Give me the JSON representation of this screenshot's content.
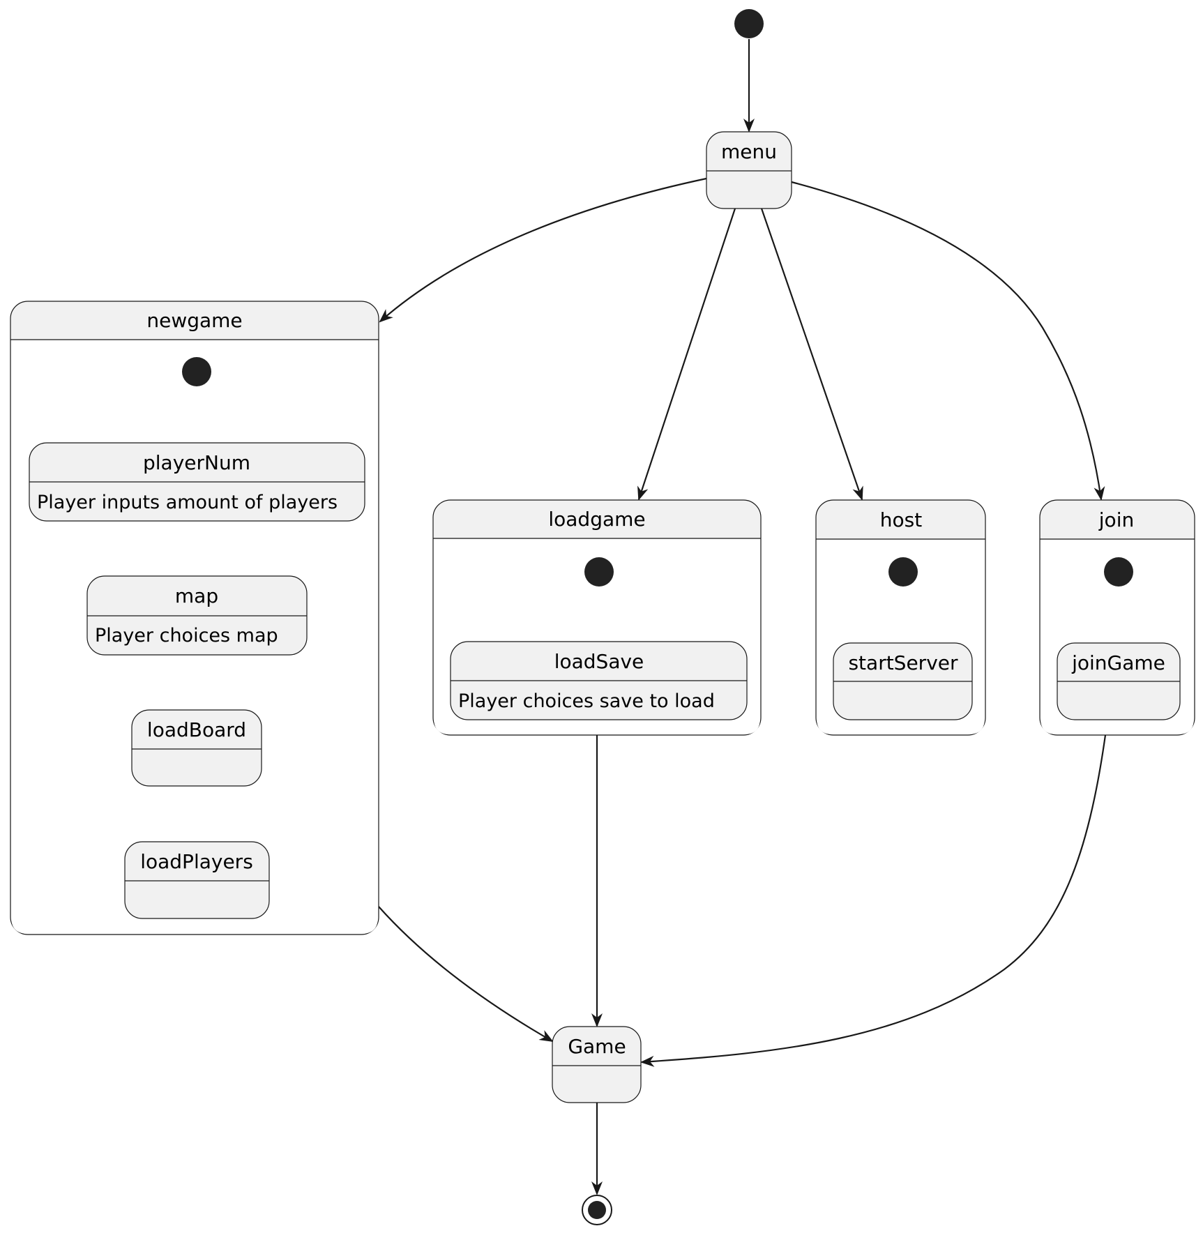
{
  "diagram": {
    "type": "state-diagram",
    "colors": {
      "state_fill": "#f1f1f1",
      "line": "#181818",
      "dot": "#222222",
      "background": "#ffffff"
    },
    "states": {
      "menu": {
        "title": "menu",
        "description": ""
      },
      "newgame": {
        "title": "newgame",
        "children": {
          "playerNum": {
            "title": "playerNum",
            "description": "Player inputs amount of players"
          },
          "map": {
            "title": "map",
            "description": "Player choices map"
          },
          "loadBoard": {
            "title": "loadBoard",
            "description": ""
          },
          "loadPlayers": {
            "title": "loadPlayers",
            "description": ""
          }
        }
      },
      "loadgame": {
        "title": "loadgame",
        "children": {
          "loadSave": {
            "title": "loadSave",
            "description": "Player choices save to load"
          }
        }
      },
      "host": {
        "title": "host",
        "children": {
          "startServer": {
            "title": "startServer",
            "description": ""
          }
        }
      },
      "join": {
        "title": "join",
        "children": {
          "joinGame": {
            "title": "joinGame",
            "description": ""
          }
        }
      },
      "Game": {
        "title": "Game",
        "description": ""
      }
    },
    "transitions": [
      {
        "from": "[*]",
        "to": "menu"
      },
      {
        "from": "menu",
        "to": "newgame"
      },
      {
        "from": "menu",
        "to": "loadgame"
      },
      {
        "from": "menu",
        "to": "host"
      },
      {
        "from": "menu",
        "to": "join"
      },
      {
        "from": "newgame.[*]",
        "to": "playerNum"
      },
      {
        "from": "playerNum",
        "to": "map"
      },
      {
        "from": "map",
        "to": "loadBoard"
      },
      {
        "from": "loadBoard",
        "to": "loadPlayers"
      },
      {
        "from": "loadgame.[*]",
        "to": "loadSave"
      },
      {
        "from": "host.[*]",
        "to": "startServer"
      },
      {
        "from": "join.[*]",
        "to": "joinGame"
      },
      {
        "from": "newgame",
        "to": "Game"
      },
      {
        "from": "loadgame",
        "to": "Game"
      },
      {
        "from": "join",
        "to": "Game"
      },
      {
        "from": "Game",
        "to": "[*]"
      }
    ]
  }
}
